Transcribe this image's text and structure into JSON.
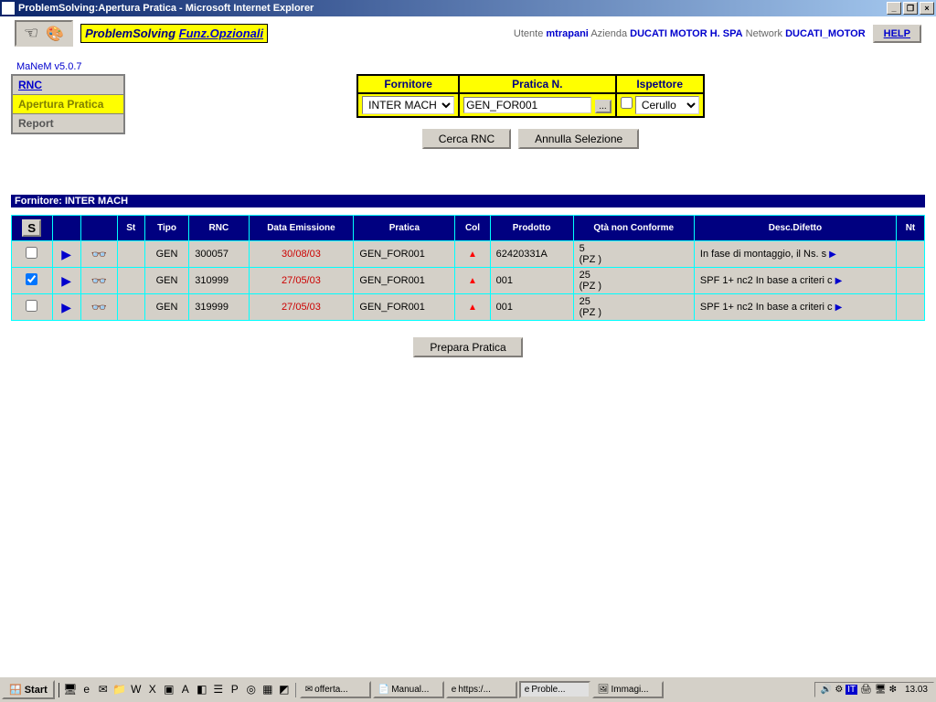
{
  "window": {
    "title": "ProblemSolving:Apertura Pratica - Microsoft Internet Explorer"
  },
  "toolbar": {
    "ps_label": "ProblemSolving",
    "funz_label": "Funz.Opzionali",
    "utente_label": "Utente",
    "utente_value": "mtrapani",
    "azienda_label": "Azienda",
    "azienda_value": "DUCATI MOTOR H. SPA",
    "network_label": "Network",
    "network_value": "DUCATI_MOTOR",
    "help_label": "HELP"
  },
  "version": "MaNeM v5.0.7",
  "sidemenu": {
    "rnc": "RNC",
    "apertura": "Apertura Pratica",
    "report": "Report"
  },
  "filter": {
    "fornitore_label": "Fornitore",
    "fornitore_value": "INTER MACH",
    "pratica_label": "Pratica N.",
    "pratica_value": "GEN_FOR001",
    "ispettore_label": "Ispettore",
    "ispettore_value": "Cerullo",
    "dots": "..."
  },
  "actions": {
    "cerca": "Cerca RNC",
    "annulla": "Annulla Selezione",
    "prepara": "Prepara Pratica"
  },
  "section": {
    "header": "Fornitore: INTER MACH"
  },
  "table": {
    "headers": {
      "s": "S",
      "st": "St",
      "tipo": "Tipo",
      "rnc": "RNC",
      "data": "Data Emissione",
      "pratica": "Pratica",
      "col": "Col",
      "prodotto": "Prodotto",
      "qta": "Qtà non Conforme",
      "desc": "Desc.Difetto",
      "nt": "Nt"
    },
    "rows": [
      {
        "checked": false,
        "tipo": "GEN",
        "rnc": "300057",
        "data": "30/08/03",
        "pratica": "GEN_FOR001",
        "prodotto": "62420331A",
        "qta": "5",
        "qta_unit": "(PZ )",
        "desc": "In fase di montaggio, il Ns. s"
      },
      {
        "checked": true,
        "tipo": "GEN",
        "rnc": "310999",
        "data": "27/05/03",
        "pratica": "GEN_FOR001",
        "prodotto": "001",
        "qta": "25",
        "qta_unit": "(PZ )",
        "desc": "SPF 1+ nc2 In base a criteri c"
      },
      {
        "checked": false,
        "tipo": "GEN",
        "rnc": "319999",
        "data": "27/05/03",
        "pratica": "GEN_FOR001",
        "prodotto": "001",
        "qta": "25",
        "qta_unit": "(PZ )",
        "desc": "SPF 1+ nc2 In base a criteri c"
      }
    ]
  },
  "taskbar": {
    "start": "Start",
    "tasks": [
      {
        "label": "offerta...",
        "icon": "✉"
      },
      {
        "label": "Manual...",
        "icon": "📄"
      },
      {
        "label": "https:/...",
        "icon": "e"
      },
      {
        "label": "Proble...",
        "icon": "e",
        "active": true
      },
      {
        "label": "Immagi...",
        "icon": "🖼"
      }
    ],
    "clock": "13.03",
    "lang": "IT"
  }
}
